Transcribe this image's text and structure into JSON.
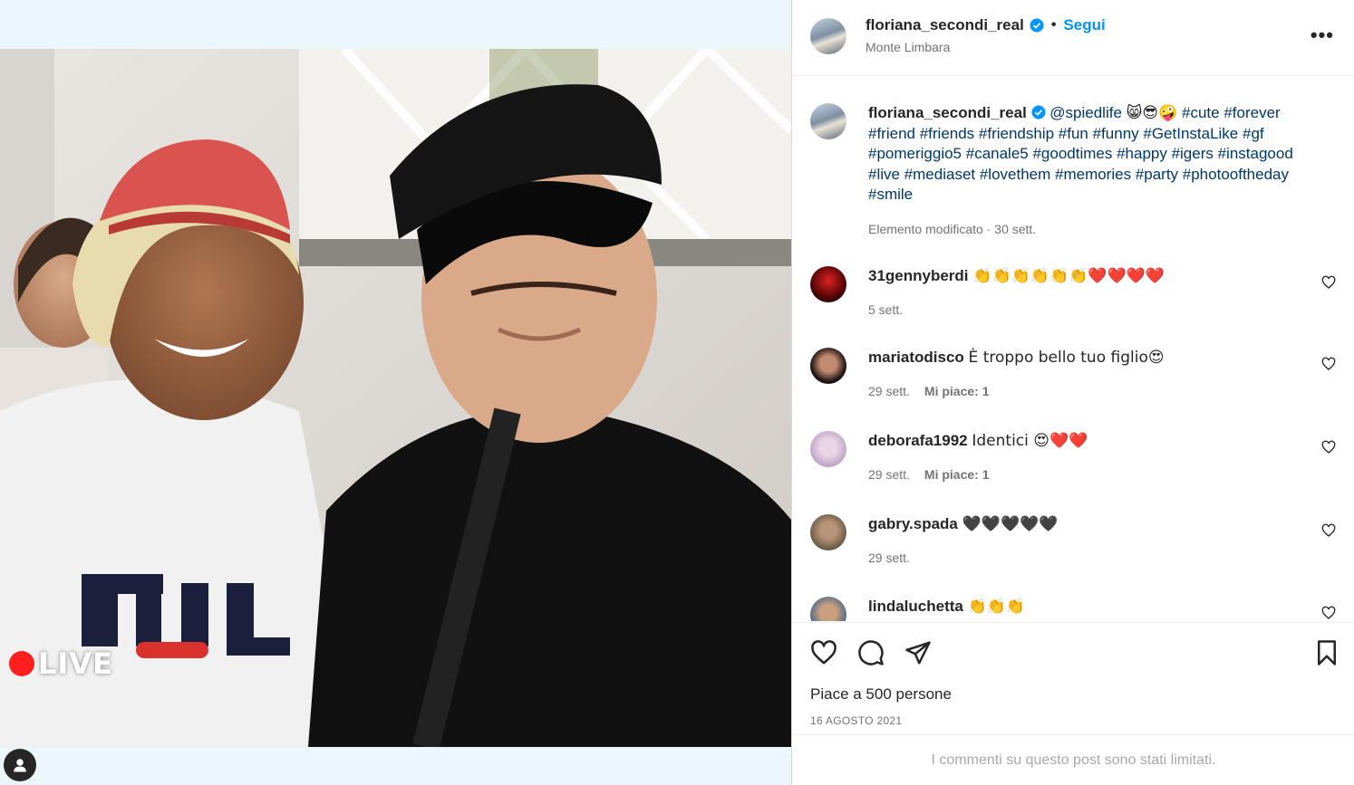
{
  "post": {
    "username": "floriana_secondi_real",
    "follow_label": "Segui",
    "separator": "•",
    "location": "Monte Limbara",
    "more_label": "•••",
    "live_label": "LIVE"
  },
  "caption": {
    "username": "floriana_secondi_real",
    "mention": "@spiedlife",
    "emojis": "😸😎🤪",
    "hashtags": "#cute #forever #friend #friends #friendship #fun #funny #GetInstaLike #gf #pomeriggio5 #canale5 #goodtimes #happy #igers #instagood #live #mediaset #lovethem #memories #party #photooftheday #smile",
    "meta": "Elemento modificato · 30 sett."
  },
  "comments": [
    {
      "username": "31gennyberdi",
      "text": "👏👏👏👏👏👏❤️❤️❤️❤️",
      "time": "5 sett.",
      "likes": ""
    },
    {
      "username": "mariatodisco",
      "text": "È troppo bello tuo figlio😍",
      "time": "29 sett.",
      "likes": "Mi piace: 1"
    },
    {
      "username": "deborafa1992",
      "text": "Identici 😍❤️❤️",
      "time": "29 sett.",
      "likes": "Mi piace: 1"
    },
    {
      "username": "gabry.spada",
      "text": "🖤🖤🖤🖤🖤",
      "time": "29 sett.",
      "likes": ""
    },
    {
      "username": "lindaluchetta",
      "text": "👏👏👏",
      "time": "",
      "likes": ""
    }
  ],
  "footer": {
    "likes_text": "Piace a 500 persone",
    "date": "16 AGOSTO 2021",
    "limited_text": "I commenti su questo post sono stati limitati."
  },
  "colors": {
    "accent": "#0095f6",
    "hashtag": "#00376b",
    "live": "#ff1f1f"
  }
}
